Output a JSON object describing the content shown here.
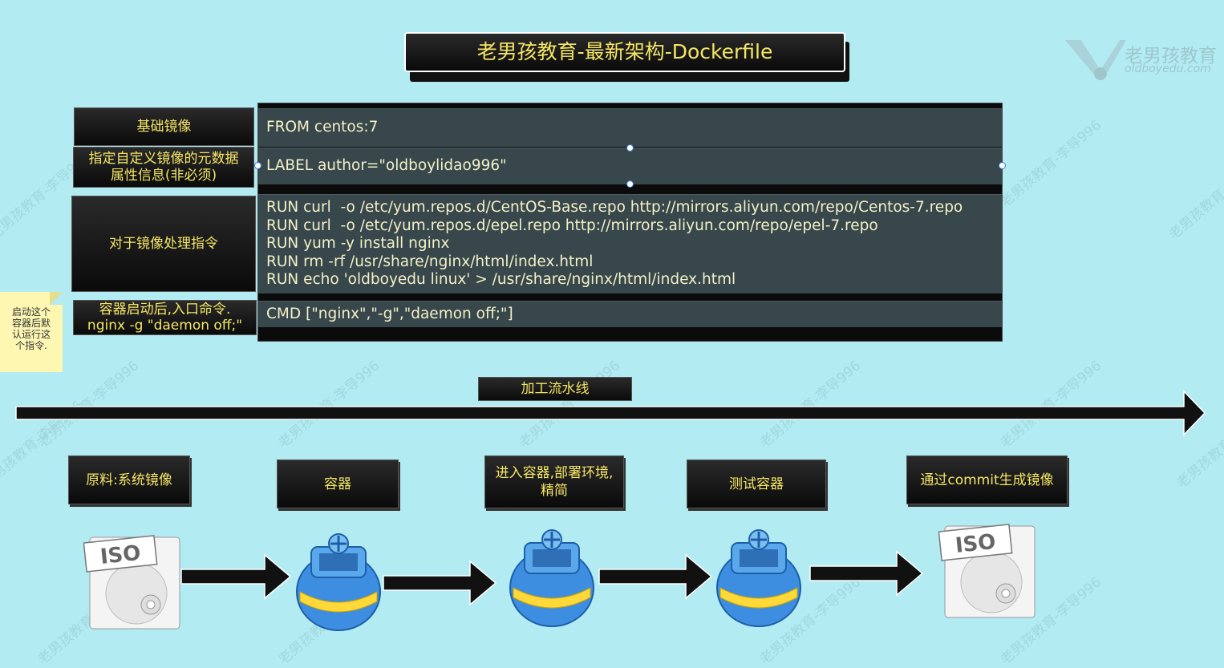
{
  "title": "老男孩教育-最新架构-Dockerfile",
  "logo": {
    "name": "老男孩教育",
    "domain": "oldboyedu.com"
  },
  "watermark": "老男孩教育-李导996",
  "rows": [
    {
      "label": "基础镜像",
      "code": [
        "FROM centos:7"
      ]
    },
    {
      "label": "指定自定义镜像的元数据\n属性信息(非必须)",
      "code": [
        "LABEL author=\"oldboylidao996\""
      ]
    },
    {
      "label": "对于镜像处理指令",
      "code": [
        "RUN curl  -o /etc/yum.repos.d/CentOS-Base.repo http://mirrors.aliyun.com/repo/Centos-7.repo",
        "RUN curl  -o /etc/yum.repos.d/epel.repo http://mirrors.aliyun.com/repo/epel-7.repo",
        "RUN yum -y install nginx",
        "RUN rm -rf /usr/share/nginx/html/index.html",
        "RUN echo 'oldboyedu linux' > /usr/share/nginx/html/index.html"
      ]
    },
    {
      "label": "容器启动后,入口命令.\nnginx -g \"daemon off;\"",
      "code": [
        "CMD [\"nginx\",\"-g\",\"daemon off;\"]"
      ]
    }
  ],
  "note": "启动这个\n容器后默\n认运行这\n个指令.",
  "pipeline": {
    "label": "加工流水线",
    "stages": [
      {
        "label": "原料:系统镜像",
        "icon": "iso-disc-icon"
      },
      {
        "label": "容器",
        "icon": "container-barrel-icon"
      },
      {
        "label": "进入容器,部署环境,\n精简",
        "icon": "container-barrel-icon"
      },
      {
        "label": "测试容器",
        "icon": "container-barrel-icon"
      },
      {
        "label": "通过commit生成镜像",
        "icon": "iso-disc-icon"
      }
    ]
  },
  "colors": {
    "background": "#b2ebf2",
    "label_text": "#f5e663",
    "code_bg": "#37474b",
    "code_text": "#f4f0c8"
  }
}
